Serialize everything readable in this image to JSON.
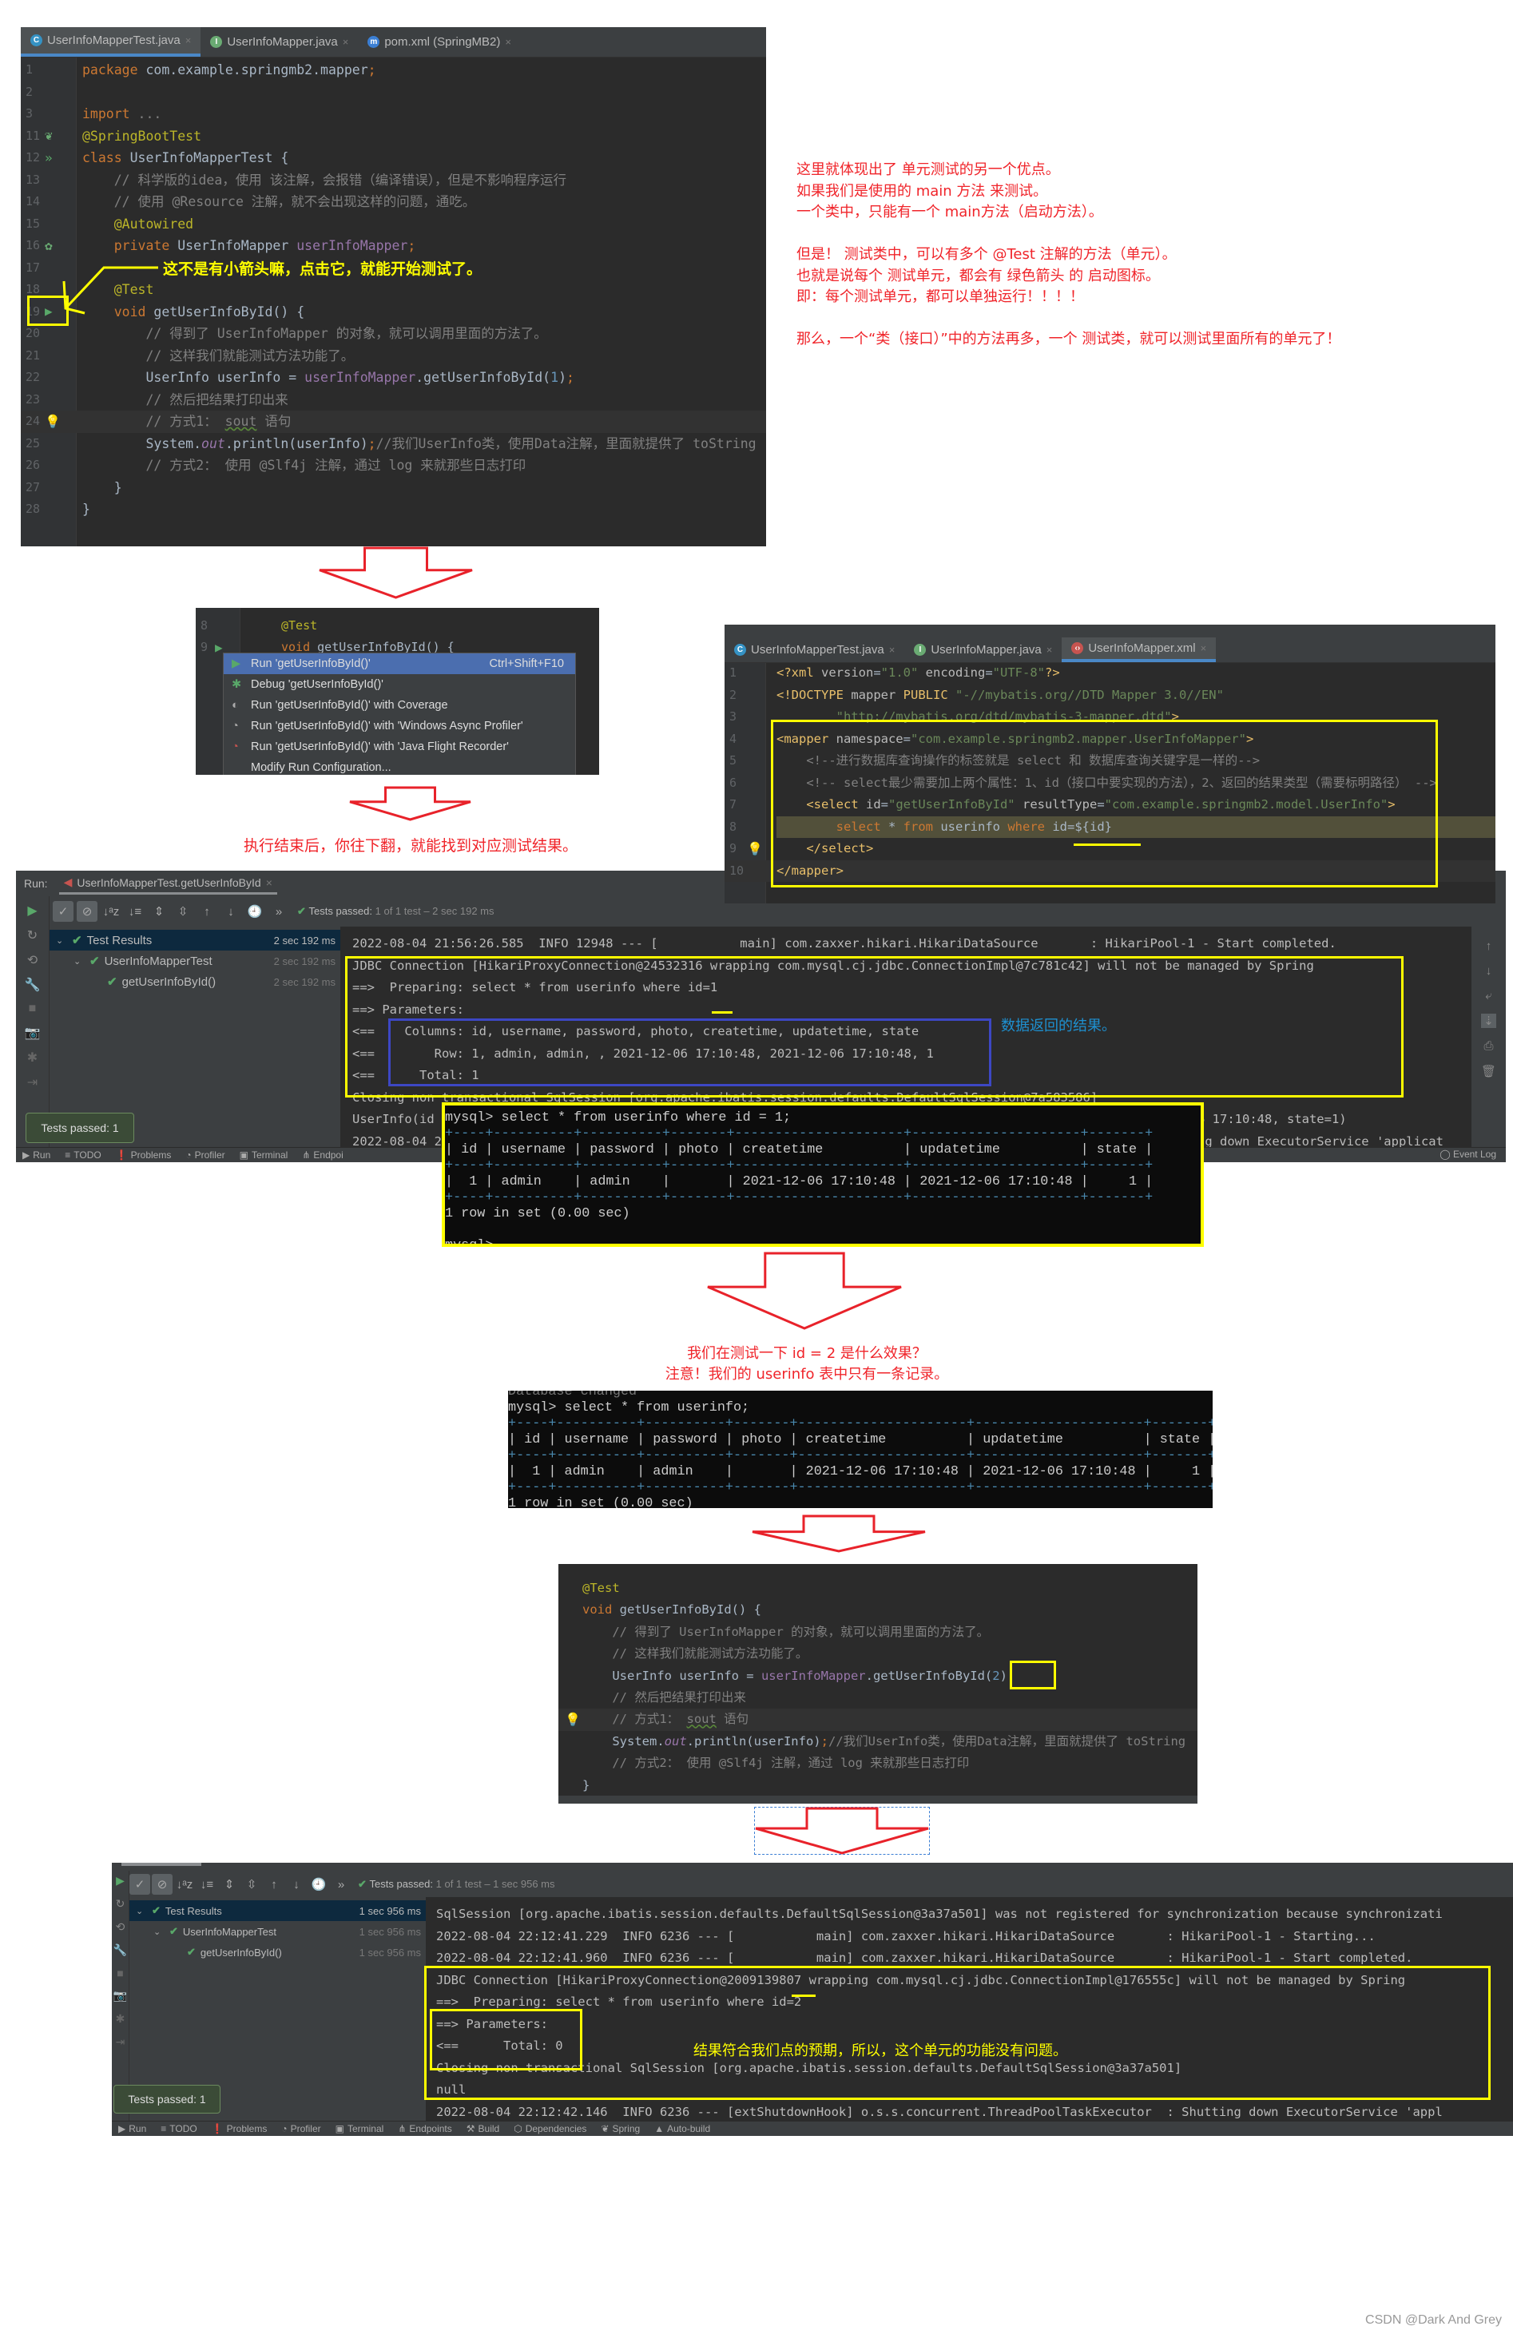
{
  "annotation_right": [
    "这里就体现出了 单元测试的另一个优点。",
    "如果我们是使用的 main 方法 来测试。",
    "一个类中，只能有一个 main方法（启动方法）。",
    "",
    "但是！ 测试类中，可以有多个 @Test 注解的方法（单元）。",
    "也就是说每个 测试单元，都会有 绿色箭头 的 启动图标。",
    "即：每个测试单元，都可以单独运行！！！！",
    "",
    "那么，一个“类（接口）”中的方法再多，一个 测试类，就可以测试里面所有的单元了！"
  ],
  "editor1": {
    "tabs": [
      {
        "label": "UserInfoMapperTest.java",
        "icon": "class-c-icon",
        "active": true
      },
      {
        "label": "UserInfoMapper.java",
        "icon": "interface-i-icon"
      },
      {
        "label": "pom.xml (SpringMB2)",
        "icon": "maven-m-icon"
      }
    ],
    "arrow_note": "这不是有小箭头嘛，点击它，就能开始测试了。",
    "lines": [
      {
        "n": "1",
        "tokens": [
          [
            "package ",
            "kw"
          ],
          [
            "com.example.springmb2.mapper",
            "id"
          ],
          [
            ";",
            "kw"
          ]
        ]
      },
      {
        "n": "2",
        "tokens": []
      },
      {
        "n": "3",
        "tokens": [
          [
            "import ",
            "kw"
          ],
          [
            "...",
            "cm"
          ]
        ]
      },
      {
        "n": "11",
        "icon": "spring-leaf-icon",
        "tokens": [
          [
            "@SpringBootTest",
            "ann"
          ]
        ]
      },
      {
        "n": "12",
        "icon": "run-all-icon",
        "tokens": [
          [
            "class ",
            "kw"
          ],
          [
            "UserInfoMapperTest {",
            "id"
          ]
        ]
      },
      {
        "n": "13",
        "tokens": [
          [
            "    // 科学版的idea，使用 该注解，会报错（编译错误），但是不影响程序运行",
            "cm"
          ]
        ]
      },
      {
        "n": "14",
        "tokens": [
          [
            "    // 使用 @Resource 注解，就不会出现这样的问题，通吃。",
            "cm"
          ]
        ]
      },
      {
        "n": "15",
        "tokens": [
          [
            "    @Autowired",
            "ann"
          ]
        ]
      },
      {
        "n": "16",
        "icon": "bean-icon",
        "tokens": [
          [
            "    private ",
            "kw"
          ],
          [
            "UserInfoMapper ",
            "id"
          ],
          [
            "userInfoMapper",
            "fld"
          ],
          [
            ";",
            "kw"
          ]
        ]
      },
      {
        "n": "17",
        "tokens": []
      },
      {
        "n": "18",
        "tokens": [
          [
            "    @Test",
            "ann"
          ]
        ]
      },
      {
        "n": "19",
        "icon": "run-icon",
        "tokens": [
          [
            "    void ",
            "kw"
          ],
          [
            "getUserInfoById() {",
            "id"
          ]
        ]
      },
      {
        "n": "20",
        "tokens": [
          [
            "        // 得到了 UserInfoMapper 的对象，就可以调用里面的方法了。",
            "cm"
          ]
        ]
      },
      {
        "n": "21",
        "tokens": [
          [
            "        // 这样我们就能测试方法功能了。",
            "cm"
          ]
        ]
      },
      {
        "n": "22",
        "tokens": [
          [
            "        UserInfo userInfo = ",
            "id"
          ],
          [
            "userInfoMapper",
            "fld"
          ],
          [
            ".getUserInfoById(",
            "id"
          ],
          [
            "1",
            "num"
          ],
          [
            ")",
            "id"
          ],
          [
            ";",
            "kw"
          ]
        ]
      },
      {
        "n": "23",
        "tokens": [
          [
            "        // 然后把结果打印出来",
            "cm"
          ]
        ]
      },
      {
        "n": "24",
        "current": true,
        "icon": "bulb-icon",
        "tokens": [
          [
            "        // 方式1： ",
            "cm"
          ],
          [
            "sout",
            "cm und"
          ],
          [
            " 语句",
            "cm"
          ]
        ]
      },
      {
        "n": "25",
        "tokens": [
          [
            "        System.",
            "id"
          ],
          [
            "out",
            "fld it"
          ],
          [
            ".println(userInfo)",
            "id"
          ],
          [
            ";",
            "kw"
          ],
          [
            "//我们UserInfo类，使用Data注解，里面就提供了 toString",
            "cm"
          ]
        ]
      },
      {
        "n": "26",
        "tokens": [
          [
            "        // 方式2： 使用 @Slf4j 注解，通过 log 来就那些日志打印",
            "cm"
          ]
        ]
      },
      {
        "n": "27",
        "tokens": [
          [
            "    }",
            "id"
          ]
        ]
      },
      {
        "n": "28",
        "tokens": [
          [
            "}",
            "id"
          ]
        ]
      }
    ]
  },
  "popup": {
    "lines": [
      {
        "n": "8",
        "tokens": [
          [
            "@Test",
            "ann"
          ]
        ]
      },
      {
        "n": "9",
        "icon": "run-icon",
        "tokens": [
          [
            "void ",
            "kw"
          ],
          [
            "getUserInfoById() {",
            "id"
          ]
        ]
      }
    ],
    "items": [
      {
        "label": "Run 'getUserInfoById()'",
        "shortcut": "Ctrl+Shift+F10",
        "icon": "run-icon",
        "selected": true
      },
      {
        "label": "Debug 'getUserInfoById()'",
        "icon": "debug-bug-icon"
      },
      {
        "label": "Run 'getUserInfoById()' with Coverage",
        "icon": "coverage-icon"
      },
      {
        "label": "Run 'getUserInfoById()' with 'Windows Async Profiler'",
        "icon": "profiler-icon"
      },
      {
        "label": "Run 'getUserInfoById()' with 'Java Flight Recorder'",
        "icon": "flight-recorder-icon"
      },
      {
        "label": "Modify Run Configuration...",
        "icon": ""
      }
    ]
  },
  "note_after_run": "执行结束后，你往下翻，就能找到对应测试结果。",
  "xml_editor": {
    "tabs": [
      {
        "label": "UserInfoMapperTest.java",
        "icon": "class-c-icon"
      },
      {
        "label": "UserInfoMapper.java",
        "icon": "interface-i-icon"
      },
      {
        "label": "UserInfoMapper.xml",
        "icon": "xml-file-icon",
        "active": true
      }
    ],
    "lines": [
      {
        "n": "1",
        "tokens": [
          [
            "<?xml ",
            "tag"
          ],
          [
            "version",
            "attr"
          ],
          [
            "=",
            "id"
          ],
          [
            "\"1.0\" ",
            "str"
          ],
          [
            "encoding",
            "attr"
          ],
          [
            "=",
            "id"
          ],
          [
            "\"UTF-8\"",
            "str"
          ],
          [
            "?>",
            "tag"
          ]
        ]
      },
      {
        "n": "2",
        "tokens": [
          [
            "<!DOCTYPE ",
            "tag"
          ],
          [
            "mapper ",
            "attr"
          ],
          [
            "PUBLIC ",
            "tag"
          ],
          [
            "\"-//mybatis.org//DTD Mapper 3.0//EN\"",
            "str"
          ]
        ]
      },
      {
        "n": "3",
        "tokens": [
          [
            "        \"http://mybatis.org/dtd/mybatis-3-mapper.dtd\"",
            "str"
          ],
          [
            ">",
            "tag"
          ]
        ]
      },
      {
        "n": "4",
        "tokens": [
          [
            "<mapper ",
            "tag"
          ],
          [
            "namespace",
            "attr"
          ],
          [
            "=",
            "id"
          ],
          [
            "\"com.example.springmb2.mapper.UserInfoMapper\"",
            "str"
          ],
          [
            ">",
            "tag"
          ]
        ]
      },
      {
        "n": "5",
        "tokens": [
          [
            "    <!--进行数据库查询操作的标签就是 select 和 数据库查询关键字是一样的-->",
            "cm"
          ]
        ]
      },
      {
        "n": "6",
        "tokens": [
          [
            "    <!-- select最少需要加上两个属性：1、id（接口中要实现的方法），2、返回的结果类型（需要标明路径） -->",
            "cm"
          ]
        ]
      },
      {
        "n": "7",
        "tokens": [
          [
            "    <select ",
            "tag"
          ],
          [
            "id",
            "attr"
          ],
          [
            "=",
            "id"
          ],
          [
            "\"getUserInfoById\" ",
            "str"
          ],
          [
            "resultType",
            "attr"
          ],
          [
            "=",
            "id"
          ],
          [
            "\"com.example.springmb2.model.UserInfo\"",
            "str"
          ],
          [
            ">",
            "tag"
          ]
        ]
      },
      {
        "n": "8",
        "hl": true,
        "tokens": [
          [
            "        select ",
            "kw"
          ],
          [
            "* ",
            "id"
          ],
          [
            "from ",
            "kw"
          ],
          [
            "userinfo ",
            "id"
          ],
          [
            "where ",
            "kw"
          ],
          [
            "id=${id}",
            "id"
          ]
        ]
      },
      {
        "n": "9",
        "icon": "bulb-icon",
        "tokens": [
          [
            "    </select>",
            "tag"
          ]
        ]
      },
      {
        "n": "10",
        "current": true,
        "tokens": [
          [
            "</mapper>",
            "tag"
          ]
        ]
      }
    ]
  },
  "run1": {
    "label": "Run:",
    "tab": "UserInfoMapperTest.getUserInfoById",
    "status": {
      "passed": "Tests passed:",
      "detail": " 1 of 1 test – 2 sec 192 ms"
    },
    "tree": [
      {
        "label": "Test Results",
        "time": "2 sec 192 ms",
        "level": 0
      },
      {
        "label": "UserInfoMapperTest",
        "time": "2 sec 192 ms",
        "level": 1
      },
      {
        "label": "getUserInfoById()",
        "time": "2 sec 192 ms",
        "level": 2
      }
    ],
    "console": [
      "2022-08-04 21:56:26.585  INFO 12948 --- [           main] com.zaxxer.hikari.HikariDataSource       : HikariPool-1 - Start completed.",
      "JDBC Connection [HikariProxyConnection@24532316 wrapping com.mysql.cj.jdbc.ConnectionImpl@7c781c42] will not be managed by Spring",
      "==>  Preparing: select * from userinfo where id=1",
      "==> Parameters: ",
      "<==    Columns: id, username, password, photo, createtime, updatetime, state",
      "<==        Row: 1, admin, admin, , 2021-12-06 17:10:48, 2021-12-06 17:10:48, 1",
      "<==      Total: 1",
      "Closing non transactional SqlSession [org.apache.ibatis.session.defaults.DefaultSqlSession@7a583586]"
    ],
    "frag_userinfo_left": "UserInfo(id",
    "frag_userinfo_right": "6 17:10:48, state=1)",
    "frag_date_left": "2022-08-04 2",
    "frag_shutdown_right": "ng down ExecutorService 'applicat",
    "result_note": "数据返回的结果。",
    "tests_passed_popup": "Tests passed: 1",
    "statusbar": [
      {
        "label": "Run",
        "icon": "run-icon"
      },
      {
        "label": "TODO",
        "icon": "list-icon"
      },
      {
        "label": "Problems",
        "icon": "problems-icon"
      },
      {
        "label": "Profiler",
        "icon": "profiler-icon"
      },
      {
        "label": "Terminal",
        "icon": "terminal-icon"
      },
      {
        "label": "Endpoi",
        "icon": "endpoints-icon"
      }
    ],
    "event_log": "Event Log"
  },
  "mysql1": {
    "prompt": "mysql> select * from userinfo where id = 1;",
    "columns": [
      "id",
      "username",
      "password",
      "photo",
      "createtime",
      "updatetime",
      "state"
    ],
    "rows": [
      [
        "1",
        "admin",
        "admin",
        "",
        "2021-12-06 17:10:48",
        "2021-12-06 17:10:48",
        "1"
      ]
    ],
    "footer": "1 row in set (0.00 sec)",
    "next_prompt": "mysql>"
  },
  "note_id2": [
    "我们在测试一下 id = 2 是什么效果？",
    "注意！我们的 userinfo 表中只有一条记录。"
  ],
  "mysql2": {
    "top": "Database changed",
    "prompt": "mysql> select * from userinfo;",
    "columns": [
      "id",
      "username",
      "password",
      "photo",
      "createtime",
      "updatetime",
      "state"
    ],
    "rows": [
      [
        "1",
        "admin",
        "admin",
        "",
        "2021-12-06 17:10:48",
        "2021-12-06 17:10:48",
        "1"
      ]
    ],
    "footer": "1 row in set (0.00 sec)"
  },
  "editor2": {
    "lines": [
      {
        "tokens": [
          [
            "@Test",
            "ann"
          ]
        ]
      },
      {
        "tokens": [
          [
            "void ",
            "kw"
          ],
          [
            "getUserInfoById() {",
            "id"
          ]
        ]
      },
      {
        "tokens": [
          [
            "    // 得到了 UserInfoMapper 的对象，就可以调用里面的方法了。",
            "cm"
          ]
        ]
      },
      {
        "tokens": [
          [
            "    // 这样我们就能测试方法功能了。",
            "cm"
          ]
        ]
      },
      {
        "tokens": [
          [
            "    UserInfo userInfo = ",
            "id"
          ],
          [
            "userInfoMapper",
            "fld"
          ],
          [
            ".getUserInfoById(",
            "id"
          ],
          [
            "2",
            "num"
          ],
          [
            ")",
            "id"
          ],
          [
            ";",
            "kw"
          ]
        ]
      },
      {
        "tokens": [
          [
            "    // 然后把结果打印出来",
            "cm"
          ]
        ]
      },
      {
        "current": true,
        "icon": "bulb-icon",
        "tokens": [
          [
            "    // 方式1： ",
            "cm"
          ],
          [
            "sout",
            "cm und"
          ],
          [
            " 语句",
            "cm"
          ]
        ]
      },
      {
        "tokens": [
          [
            "    System.",
            "id"
          ],
          [
            "out",
            "fld it"
          ],
          [
            ".println(userInfo)",
            "id"
          ],
          [
            ";",
            "kw"
          ],
          [
            "//我们UserInfo类，使用Data注解，里面就提供了 toString",
            "cm"
          ]
        ]
      },
      {
        "tokens": [
          [
            "    // 方式2： 使用 @Slf4j 注解，通过 log 来就那些日志打印",
            "cm"
          ]
        ]
      },
      {
        "tokens": [
          [
            "}",
            "id"
          ]
        ]
      }
    ]
  },
  "run2": {
    "status": {
      "passed": "Tests passed:",
      "detail": " 1 of 1 test – 1 sec 956 ms"
    },
    "tree": [
      {
        "label": "Test Results",
        "time": "1 sec 956 ms",
        "level": 0
      },
      {
        "label": "UserInfoMapperTest",
        "time": "1 sec 956 ms",
        "level": 1
      },
      {
        "label": "getUserInfoById()",
        "time": "1 sec 956 ms",
        "level": 2
      }
    ],
    "console": [
      "SqlSession [org.apache.ibatis.session.defaults.DefaultSqlSession@3a37a501] was not registered for synchronization because synchronizati",
      "2022-08-04 22:12:41.229  INFO 6236 --- [           main] com.zaxxer.hikari.HikariDataSource       : HikariPool-1 - Starting...",
      "2022-08-04 22:12:41.960  INFO 6236 --- [           main] com.zaxxer.hikari.HikariDataSource       : HikariPool-1 - Start completed.",
      "JDBC Connection [HikariProxyConnection@2009139807 wrapping com.mysql.cj.jdbc.ConnectionImpl@176555c] will not be managed by Spring",
      "==>  Preparing: select * from userinfo where id=2",
      "==> Parameters: ",
      "<==      Total: 0",
      "Closing non transactional SqlSession [org.apache.ibatis.session.defaults.DefaultSqlSession@3a37a501]",
      "null",
      "2022-08-04 22:12:42.146  INFO 6236 --- [extShutdownHook] o.s.s.concurrent.ThreadPoolTaskExecutor  : Shutting down ExecutorService 'appl"
    ],
    "result_note": "结果符合我们点的预期，所以，这个单元的功能没有问题。",
    "tests_passed_popup": "Tests passed: 1",
    "statusbar": [
      {
        "label": "Run",
        "icon": "run-icon"
      },
      {
        "label": "TODO",
        "icon": "list-icon"
      },
      {
        "label": "Problems",
        "icon": "problems-icon"
      },
      {
        "label": "Profiler",
        "icon": "profiler-icon"
      },
      {
        "label": "Terminal",
        "icon": "terminal-icon"
      },
      {
        "label": "Endpoints",
        "icon": "endpoints-icon"
      },
      {
        "label": "Build",
        "icon": "build-icon"
      },
      {
        "label": "Dependencies",
        "icon": "dependencies-icon"
      },
      {
        "label": "Spring",
        "icon": "spring-leaf-icon"
      },
      {
        "label": "Auto-build",
        "icon": "auto-build-icon"
      }
    ]
  },
  "watermark": "CSDN @Dark And Grey",
  "colors": {
    "annotation_red": "#f0242a",
    "highlight_yellow": "#ffff00",
    "result_blue": "#1e90d0",
    "ide_bg": "#2b2b2b",
    "pass_green": "#59a869"
  }
}
